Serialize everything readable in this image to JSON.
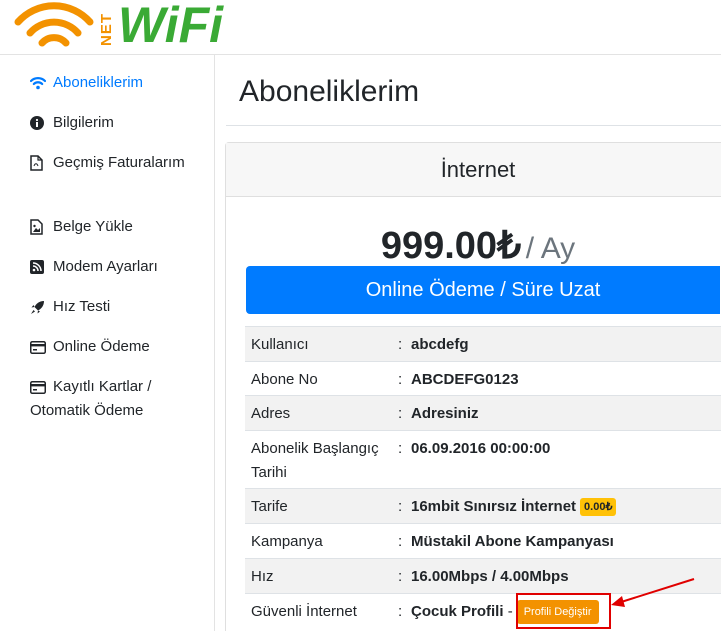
{
  "brand": {
    "net": "NET",
    "wifi": "WiFi",
    "orange": "#f39200",
    "green": "#3aaa35"
  },
  "sidebar": {
    "items": [
      {
        "icon": "wifi-icon",
        "label": "Aboneliklerim",
        "active": true
      },
      {
        "icon": "info-circle-icon",
        "label": "Bilgilerim"
      },
      {
        "icon": "pdf-file-icon",
        "label": "Geçmiş Faturalarım"
      },
      {
        "icon": "image-file-icon",
        "label": "Belge Yükle"
      },
      {
        "icon": "rss-square-icon",
        "label": "Modem Ayarları"
      },
      {
        "icon": "rocket-icon",
        "label": "Hız Testi"
      },
      {
        "icon": "credit-card-icon",
        "label": "Online Ödeme"
      },
      {
        "icon": "credit-card-icon",
        "label": "Kayıtlı Kartlar / Otomatik Ödeme"
      }
    ]
  },
  "main": {
    "title": "Aboneliklerim",
    "card": {
      "header": "İnternet",
      "price": "999.00₺",
      "period": "/ Ay",
      "pay_button": "Online Ödeme / Süre Uzat",
      "rows": [
        {
          "key": "Kullanıcı",
          "value": "abcdefg"
        },
        {
          "key": "Abone No",
          "value": "ABCDEFG0123"
        },
        {
          "key": "Adres",
          "value": "Adresiniz"
        },
        {
          "key": "Abonelik Başlangıç Tarihi",
          "value": "06.09.2016 00:00:00"
        },
        {
          "key": "Tarife",
          "value": "16mbit Sınırsız İnternet",
          "badge": "0.00₺"
        },
        {
          "key": "Kampanya",
          "value": "Müstakil Abone Kampanyası"
        },
        {
          "key": "Hız",
          "value": "16.00Mbps / 4.00Mbps"
        },
        {
          "key": "Güvenli İnternet",
          "value": "Çocuk Profili",
          "suffix": "-",
          "button": "Profili Değiştir"
        }
      ],
      "separator": ":"
    }
  },
  "colors": {
    "primary": "#007bff",
    "warning": "#ffc107",
    "orange_button": "#f39200",
    "highlight": "#e00000"
  }
}
